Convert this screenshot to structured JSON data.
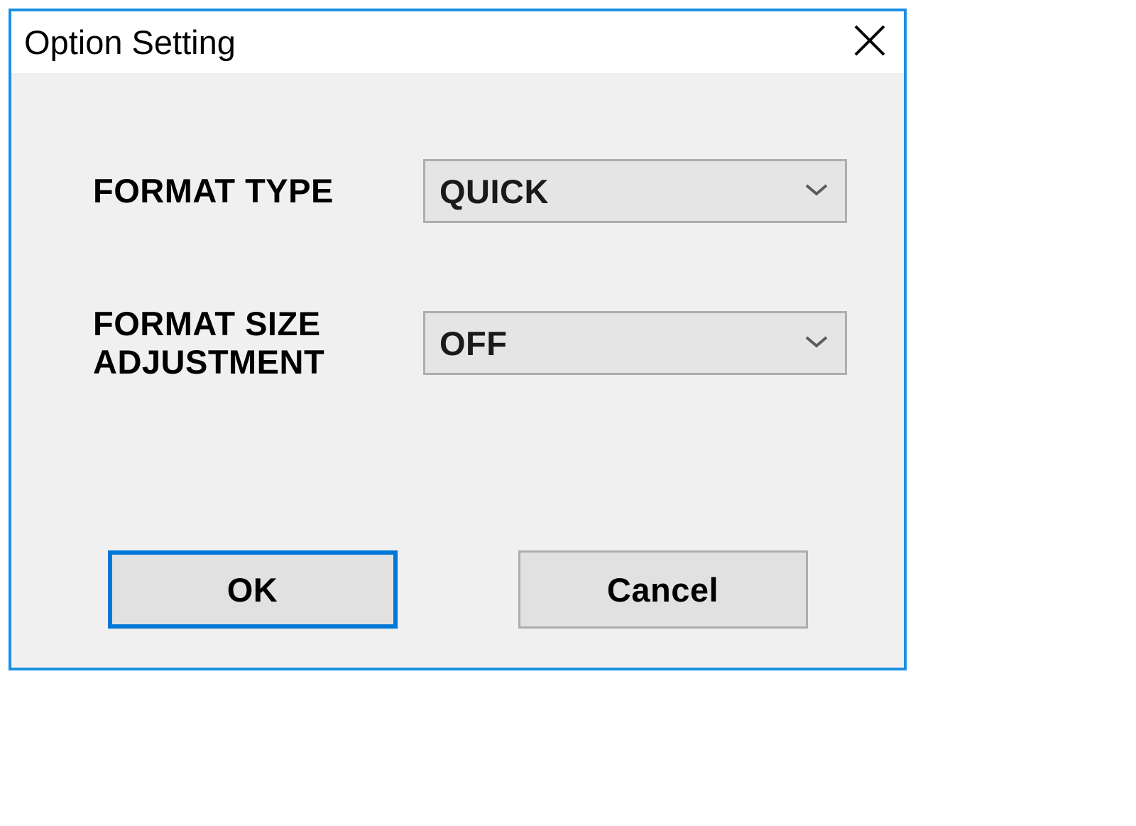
{
  "dialog": {
    "title": "Option Setting"
  },
  "fields": {
    "format_type": {
      "label": "FORMAT TYPE",
      "value": "QUICK"
    },
    "format_size_adjustment": {
      "label": "FORMAT SIZE ADJUSTMENT",
      "value": "OFF"
    }
  },
  "buttons": {
    "ok": "OK",
    "cancel": "Cancel"
  }
}
